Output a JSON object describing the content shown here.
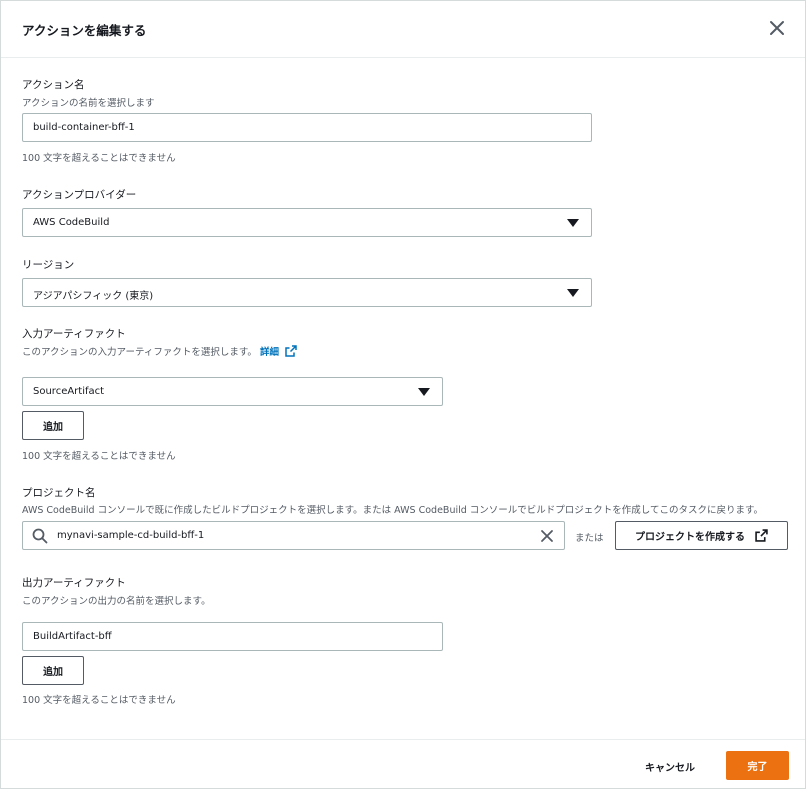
{
  "header": {
    "title": "アクションを編集する"
  },
  "action_name": {
    "label": "アクション名",
    "description": "アクションの名前を選択します",
    "value": "build-container-bff-1",
    "hint": "100 文字を超えることはできません"
  },
  "provider": {
    "label": "アクションプロバイダー",
    "value": "AWS CodeBuild"
  },
  "region": {
    "label": "リージョン",
    "value": "アジアパシフィック (東京)"
  },
  "input_artifact": {
    "label": "入力アーティファクト",
    "description": "このアクションの入力アーティファクトを選択します。",
    "link": "詳細",
    "value": "SourceArtifact",
    "add_label": "追加",
    "hint": "100 文字を超えることはできません"
  },
  "project": {
    "label": "プロジェクト名",
    "description": "AWS CodeBuild コンソールで既に作成したビルドプロジェクトを選択します。または AWS CodeBuild コンソールでビルドプロジェクトを作成してこのタスクに戻ります。",
    "value": "mynavi-sample-cd-build-bff-1",
    "or_text": "または",
    "create_label": "プロジェクトを作成する"
  },
  "output_artifact": {
    "label": "出力アーティファクト",
    "description": "このアクションの出力の名前を選択します。",
    "value": "BuildArtifact-bff",
    "add_label": "追加",
    "hint": "100 文字を超えることはできません"
  },
  "footer": {
    "cancel_label": "キャンセル",
    "done_label": "完了"
  },
  "colors": {
    "primary": "#ec7211",
    "link": "#0073bb",
    "border": "#aab7b8"
  }
}
